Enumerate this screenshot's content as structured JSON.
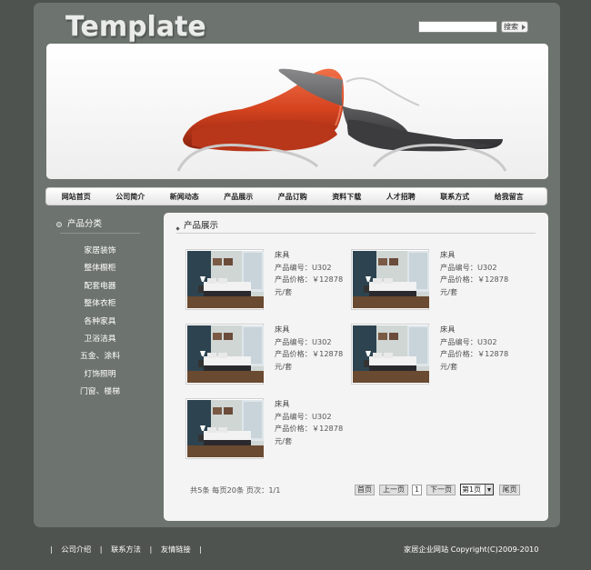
{
  "header": {
    "logo_text": "Template",
    "search_placeholder": "",
    "search_button": "搜索"
  },
  "nav": {
    "items": [
      "网站首页",
      "公司简介",
      "新闻动态",
      "产品展示",
      "产品订购",
      "资料下载",
      "人才招聘",
      "联系方式",
      "给我留言"
    ]
  },
  "sidebar": {
    "title": "产品分类",
    "items": [
      "家居装饰",
      "整体橱柜",
      "配套电器",
      "整体衣柜",
      "各种家具",
      "卫浴洁具",
      "五金、涂料",
      "灯饰照明",
      "门窗、楼梯"
    ]
  },
  "main": {
    "title": "产品展示",
    "products": [
      {
        "name": "床具",
        "code": "产品编号：U302",
        "price": "产品价格：￥12878",
        "unit": "元/套"
      },
      {
        "name": "床具",
        "code": "产品编号：U302",
        "price": "产品价格：￥12878",
        "unit": "元/套"
      },
      {
        "name": "床具",
        "code": "产品编号：U302",
        "price": "产品价格：￥12878",
        "unit": "元/套"
      },
      {
        "name": "床具",
        "code": "产品编号：U302",
        "price": "产品价格：￥12878",
        "unit": "元/套"
      },
      {
        "name": "床具",
        "code": "产品编号：U302",
        "price": "产品价格：￥12878",
        "unit": "元/套"
      }
    ]
  },
  "pager": {
    "info": "共5条  每页20条  页次：1/1",
    "first": "首页",
    "prev": "上一页",
    "current": "1",
    "next": "下一页",
    "select_value": "第1页",
    "last": "尾页"
  },
  "footer": {
    "links": [
      "公司介绍",
      "联系方法",
      "友情链接"
    ],
    "separator": "|",
    "copyright": "家居企业网站  Copyright(C)2009-2010"
  },
  "colors": {
    "page_bg": "#4f5350",
    "frame_bg": "#6d736f",
    "panel_bg": "#f4f4f4",
    "sofa_red": "#d5431f",
    "sofa_gray": "#5a5a5c"
  }
}
